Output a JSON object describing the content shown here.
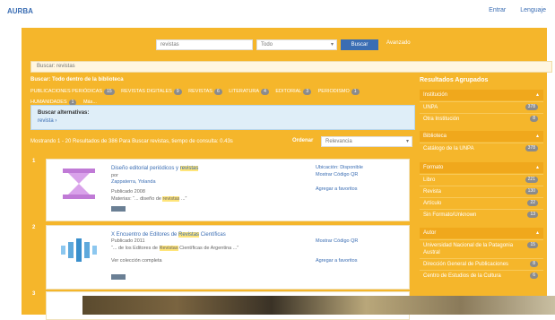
{
  "header": {
    "logo": "AURBA",
    "links": [
      "Entrar",
      "Lenguaje"
    ]
  },
  "search": {
    "query": "revistas",
    "type": "Todo",
    "button": "Buscar",
    "advanced": "Avanzado"
  },
  "searched": "Buscar: revistas",
  "results_heading": "Buscar: Todo dentro de la biblioteca",
  "facet_suggestions": [
    {
      "label": "PUBLICACIONES PERIÓDICAS",
      "count": "15"
    },
    {
      "label": "REVISTAS DIGITALES",
      "count": "9"
    },
    {
      "label": "REVISTAS",
      "count": "6"
    },
    {
      "label": "LITERATURA",
      "count": "4"
    },
    {
      "label": "EDITORIAL",
      "count": "3"
    },
    {
      "label": "PERIODISMO",
      "count": "1"
    },
    {
      "label": "HUMANIDADES",
      "count": "1"
    }
  ],
  "more_link": "Más...",
  "alternate": {
    "title": "Buscar alternativas:",
    "link": "revista ›"
  },
  "count_line": "Mostrando 1 - 20 Resultados de 386 Para Buscar revistas, tiempo de consulta: 0.43s",
  "sort": {
    "label": "Ordenar",
    "value": "Relevancia"
  },
  "records": [
    {
      "number": "1",
      "title_pre": "Diseño editorial periódicos y ",
      "title_hl": "revistas",
      "by": "por",
      "author": "Zappaterra, Yolanda",
      "published": "Publicado 2008",
      "materia_pre": "Materias: “... diseño de ",
      "materia_hl": "revistas",
      "materia_post": " ...”",
      "format": "Libro",
      "right_line1": "Ubicación: Disponible",
      "right_line2": "Mostrar Código QR",
      "right_line3": "Agregar a favoritos"
    },
    {
      "number": "2",
      "title_pre": "X Encuentro de Editores de ",
      "title_hl": "Revistas",
      "title_post": " Científicas",
      "published": "Publicado 2011",
      "desc_pre": "“... de los Editores de ",
      "desc_hl": "Revistas",
      "desc_post": " Científicas de Argentina ...”",
      "desc2": "Ver colección completa",
      "format": "Revista",
      "right_line1": "Mostrar Código QR",
      "right_line2": "Agregar a favoritos"
    }
  ],
  "sidebar": {
    "title": "Resultados Agrupados",
    "groups": [
      {
        "label": "Institución",
        "items": [
          {
            "label": "UNPA",
            "count": "378"
          },
          {
            "label": "Otra Institución",
            "count": "8"
          }
        ]
      },
      {
        "label": "Biblioteca",
        "items": [
          {
            "label": "Catálogo de la UNPA",
            "count": "378"
          }
        ]
      },
      {
        "label": "Formato",
        "items": [
          {
            "label": "Libro",
            "count": "221"
          },
          {
            "label": "Revista",
            "count": "130"
          },
          {
            "label": "Artículo",
            "count": "22"
          },
          {
            "label": "Sin Formato/Unknown",
            "count": "13"
          }
        ]
      },
      {
        "label": "Autor",
        "items": [
          {
            "label": "Universidad Nacional de la Patagonia Austral",
            "count": "15"
          },
          {
            "label": "Dirección General de Publicaciones",
            "count": "8"
          },
          {
            "label": "Centro de Estudios de la Cultura",
            "count": "6"
          }
        ]
      }
    ]
  },
  "colors": {
    "panel": "#f5b62b",
    "link": "#3a6db3",
    "highlight": "#ffe57a"
  }
}
